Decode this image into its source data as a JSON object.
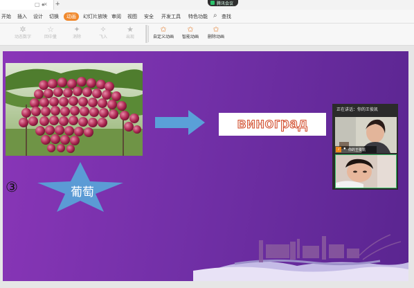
{
  "tabbar": {
    "doc_tab_controls": "▢ ●",
    "close_glyph": "×",
    "new_tab_glyph": "+"
  },
  "meeting_indicator": "腾讯会议",
  "menubar": {
    "items": [
      "开始",
      "插入",
      "设计",
      "切换",
      "动画",
      "幻灯片放映",
      "审阅",
      "视图",
      "安全",
      "开发工具",
      "特色功能"
    ],
    "active": "动画",
    "search_label": "查找",
    "accent_color": "#f0892d"
  },
  "ribbon": {
    "disabled_buttons": [
      {
        "label": "动态数字",
        "icon": "animation-number-icon",
        "glyph": "✲"
      },
      {
        "label": "回中量",
        "icon": "star-icon",
        "glyph": "☆"
      },
      {
        "label": "消除",
        "icon": "erase-icon",
        "glyph": "✦"
      },
      {
        "label": "飞入",
        "icon": "fly-in-icon",
        "glyph": "✧"
      },
      {
        "label": "出现",
        "icon": "appear-icon",
        "glyph": "★"
      }
    ],
    "active_buttons": [
      {
        "label": "自定义动画",
        "icon": "custom-animation-icon",
        "glyph": "✩"
      },
      {
        "label": "智能动画",
        "icon": "smart-animation-icon",
        "glyph": "✩"
      },
      {
        "label": "删除动画",
        "icon": "delete-animation-icon",
        "glyph": "✩"
      }
    ]
  },
  "slide": {
    "russian_word": "виноград",
    "star_text": "葡萄",
    "circled_number": "③",
    "background_color": "#7a32ad",
    "arrow_color": "#5aa0d8",
    "star_color": "#5b9bd5"
  },
  "call_panel": {
    "status_text": "正在讲话：你的王俊凯",
    "participant_name": "你的王俊凯",
    "speaker_badge": "♪",
    "mic_glyph": "🎤"
  }
}
